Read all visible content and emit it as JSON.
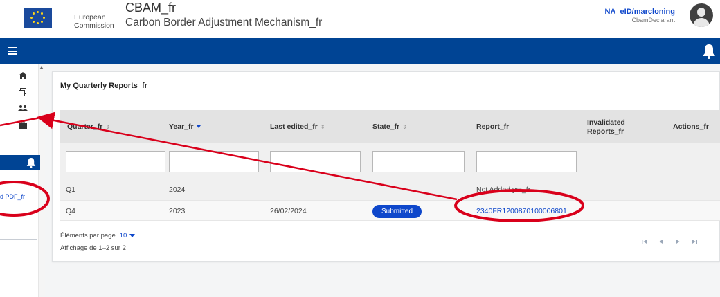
{
  "header": {
    "org_line1": "European",
    "org_line2": "Commission",
    "app_title": "CBAM_fr",
    "app_subtitle": "Carbon Border Adjustment Mechanism_fr",
    "user_name": "NA_eID/marcloning",
    "user_role": "CbamDeclarant"
  },
  "sidebar": {
    "items": [
      {
        "icon": "home-icon"
      },
      {
        "icon": "copy-icon"
      },
      {
        "icon": "users-icon"
      },
      {
        "icon": "briefcase-icon"
      }
    ],
    "link_label": "d PDF_fr"
  },
  "main": {
    "card_title": "My Quarterly Reports_fr",
    "columns": [
      {
        "label": "Quarter_fr",
        "sort": "none"
      },
      {
        "label": "Year_fr",
        "sort": "desc"
      },
      {
        "label": "Last edited_fr",
        "sort": "none"
      },
      {
        "label": "State_fr",
        "sort": "none"
      },
      {
        "label": "Report_fr",
        "sort": "none"
      },
      {
        "label": "Invalidated Reports_fr",
        "sort": "none"
      },
      {
        "label": "Actions_fr",
        "sort": "none"
      }
    ],
    "rows": [
      {
        "quarter": "Q1",
        "year": "2024",
        "last_edited": "",
        "state": "",
        "report": "Not Added yet_fr"
      },
      {
        "quarter": "Q4",
        "year": "2023",
        "last_edited": "26/02/2024",
        "state": "Submitted",
        "report": "2340FR1200870100006801"
      }
    ],
    "pager": {
      "per_page_label": "Éléments par page",
      "per_page_value": "10",
      "range_text": "Affichage de 1–2 sur 2"
    }
  },
  "colors": {
    "brand_blue": "#004494",
    "link_blue": "#0e47cb",
    "annotation_red": "#d9001b"
  }
}
